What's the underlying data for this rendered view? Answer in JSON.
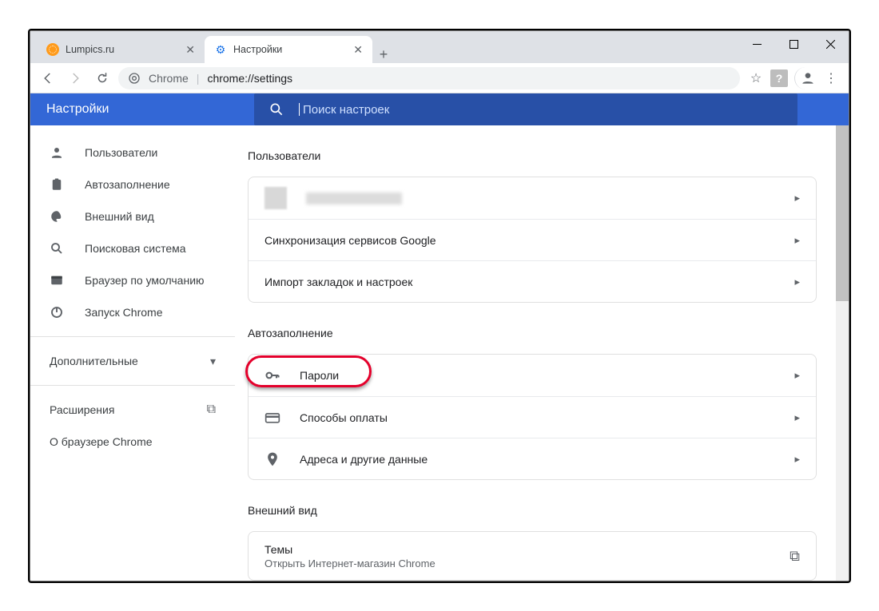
{
  "window": {
    "tabs": [
      {
        "title": "Lumpics.ru",
        "active": false
      },
      {
        "title": "Настройки",
        "active": true
      }
    ]
  },
  "addressbar": {
    "scheme_label": "Chrome",
    "url": "chrome://settings"
  },
  "app": {
    "title": "Настройки",
    "search_placeholder": "Поиск настроек"
  },
  "sidebar": {
    "items": [
      {
        "label": "Пользователи"
      },
      {
        "label": "Автозаполнение"
      },
      {
        "label": "Внешний вид"
      },
      {
        "label": "Поисковая система"
      },
      {
        "label": "Браузер по умолчанию"
      },
      {
        "label": "Запуск Chrome"
      }
    ],
    "advanced_label": "Дополнительные",
    "extensions_label": "Расширения",
    "about_label": "О браузере Chrome"
  },
  "sections": {
    "users": {
      "title": "Пользователи",
      "rows": {
        "sync": "Синхронизация сервисов Google",
        "import": "Импорт закладок и настроек"
      }
    },
    "autofill": {
      "title": "Автозаполнение",
      "rows": {
        "passwords": "Пароли",
        "payment": "Способы оплаты",
        "addresses": "Адреса и другие данные"
      }
    },
    "appearance": {
      "title": "Внешний вид",
      "themes_title": "Темы",
      "themes_desc": "Открыть Интернет-магазин Chrome"
    }
  }
}
